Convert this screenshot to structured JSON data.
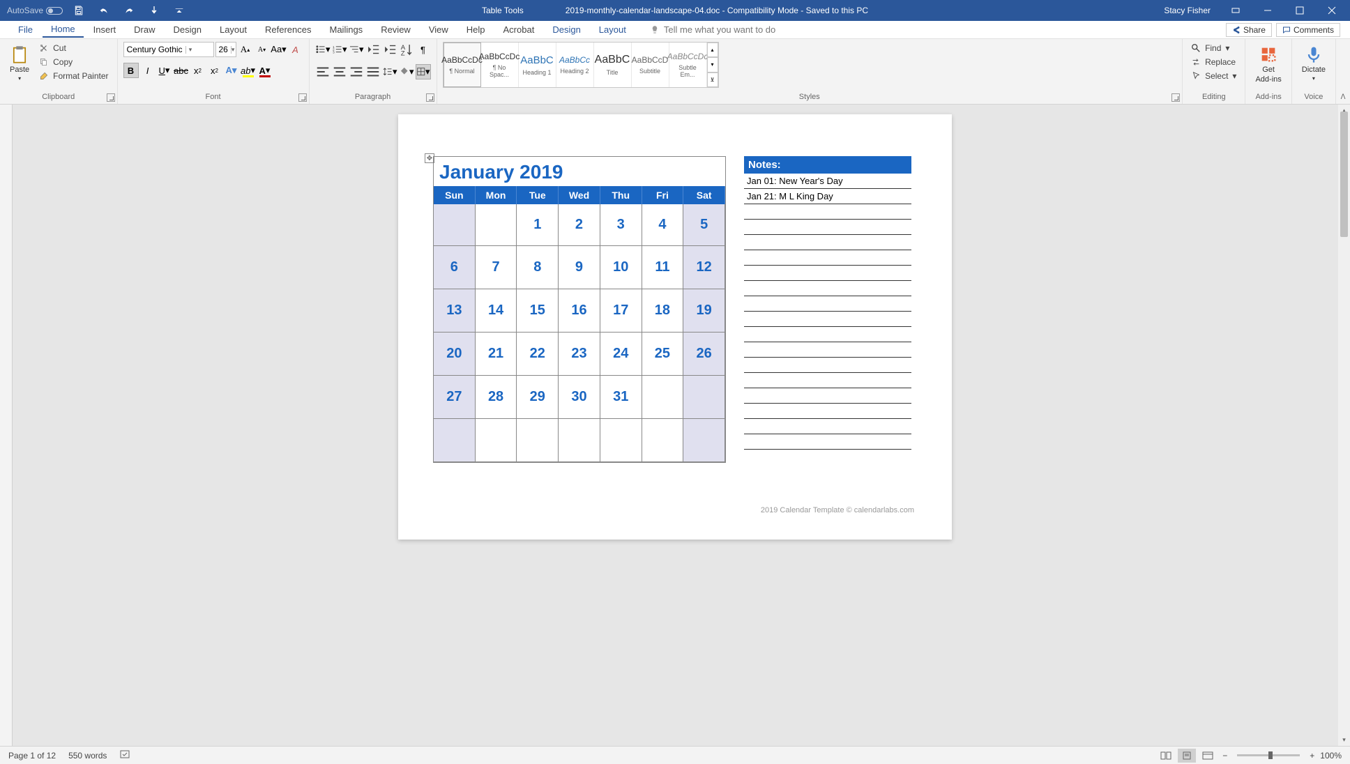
{
  "titlebar": {
    "autosave": "AutoSave",
    "tabletools": "Table Tools",
    "doc": "2019-monthly-calendar-landscape-04.doc  -  Compatibility Mode  -  Saved to this PC",
    "user": "Stacy Fisher"
  },
  "tabs": {
    "file": "File",
    "home": "Home",
    "insert": "Insert",
    "draw": "Draw",
    "design": "Design",
    "layout": "Layout",
    "references": "References",
    "mailings": "Mailings",
    "review": "Review",
    "view": "View",
    "help": "Help",
    "acrobat": "Acrobat",
    "design2": "Design",
    "layout2": "Layout",
    "tellme": "Tell me what you want to do",
    "share": "Share",
    "comments": "Comments"
  },
  "clipboard": {
    "paste": "Paste",
    "cut": "Cut",
    "copy": "Copy",
    "format": "Format Painter",
    "label": "Clipboard"
  },
  "font": {
    "name": "Century Gothic",
    "size": "26",
    "label": "Font"
  },
  "paragraph": {
    "label": "Paragraph"
  },
  "styles": {
    "label": "Styles",
    "items": [
      {
        "preview": "AaBbCcDc",
        "name": "¶ Normal"
      },
      {
        "preview": "AaBbCcDc",
        "name": "¶ No Spac..."
      },
      {
        "preview": "AaBbC",
        "name": "Heading 1"
      },
      {
        "preview": "AaBbCc",
        "name": "Heading 2"
      },
      {
        "preview": "AaBbC",
        "name": "Title"
      },
      {
        "preview": "AaBbCcD",
        "name": "Subtitle"
      },
      {
        "preview": "AaBbCcDc",
        "name": "Subtle Em..."
      }
    ]
  },
  "editing": {
    "find": "Find",
    "replace": "Replace",
    "select": "Select",
    "label": "Editing"
  },
  "addins": {
    "get": "Get",
    "addins": "Add-ins",
    "label": "Add-ins"
  },
  "voice": {
    "dictate": "Dictate",
    "label": "Voice"
  },
  "calendar": {
    "title": "January 2019",
    "days": [
      "Sun",
      "Mon",
      "Tue",
      "Wed",
      "Thu",
      "Fri",
      "Sat"
    ],
    "rows": [
      [
        "",
        "",
        "1",
        "2",
        "3",
        "4",
        "5"
      ],
      [
        "6",
        "7",
        "8",
        "9",
        "10",
        "11",
        "12"
      ],
      [
        "13",
        "14",
        "15",
        "16",
        "17",
        "18",
        "19"
      ],
      [
        "20",
        "21",
        "22",
        "23",
        "24",
        "25",
        "26"
      ],
      [
        "27",
        "28",
        "29",
        "30",
        "31",
        "",
        ""
      ],
      [
        "",
        "",
        "",
        "",
        "",
        "",
        ""
      ]
    ]
  },
  "notes": {
    "head": "Notes:",
    "items": [
      "Jan 01: New Year's Day",
      "Jan 21: M L King Day"
    ]
  },
  "footer": "2019 Calendar Template © calendarlabs.com",
  "status": {
    "page": "Page 1 of 12",
    "words": "550 words",
    "zoom": "100%"
  }
}
